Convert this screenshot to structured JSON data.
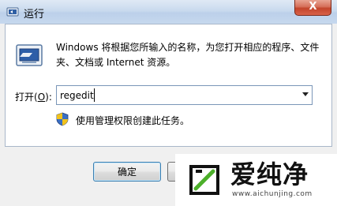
{
  "window": {
    "title": "运行",
    "close_label": "X"
  },
  "icons": {
    "title": "run-icon",
    "main": "run-icon",
    "shield": "uac-shield-icon",
    "dropdown": "chevron-down-icon"
  },
  "main": {
    "description": "Windows 将根据您所输入的名称，为您打开相应的程序、文件夹、文档或 Internet 资源。",
    "open_label_prefix": "打开(",
    "open_label_key": "O",
    "open_label_suffix": "):",
    "command_value": "regedit",
    "admin_note": "使用管理权限创建此任务。"
  },
  "buttons": {
    "ok_label": "确定"
  },
  "watermark": {
    "brand": "爱纯净",
    "url": "www.aichunjing.com"
  },
  "colors": {
    "border_focus": "#3c7fb1",
    "titlebar": "#c9daee",
    "close": "#c3442b"
  }
}
